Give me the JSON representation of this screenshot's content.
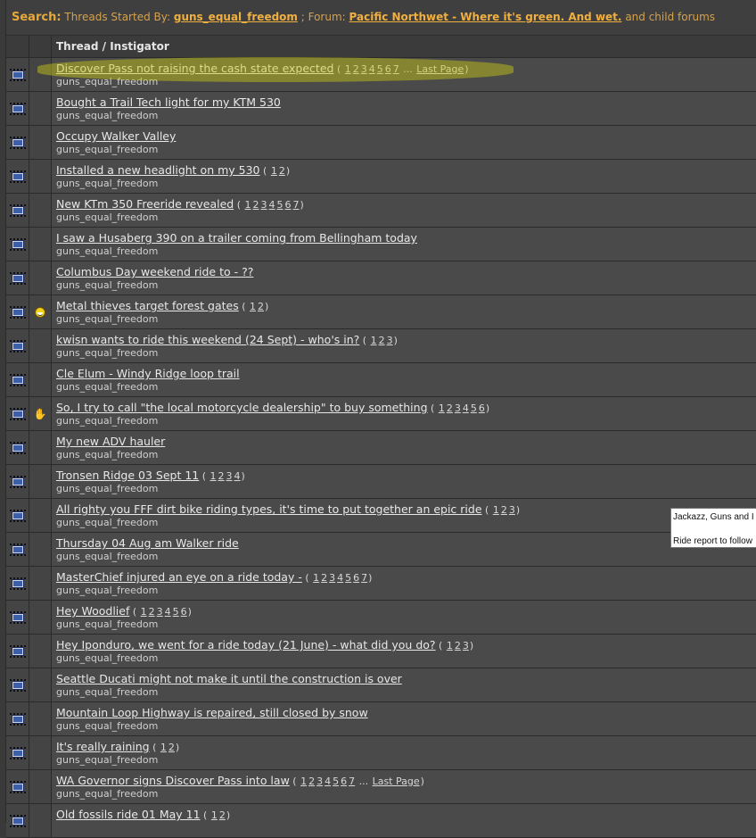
{
  "search": {
    "label": "Search:",
    "prefix": "Threads Started By:",
    "user": "guns_equal_freedom",
    "forum_sep": "; Forum:",
    "forum": "Pacific Northwet - Where it's green. And wet.",
    "suffix": "and child forums"
  },
  "header": {
    "thread_col": "Thread / Instigator"
  },
  "threads": [
    {
      "title": "Discover Pass not raising the cash state expected",
      "pages": [
        "1",
        "2",
        "3",
        "4",
        "5",
        "6",
        "7"
      ],
      "ellipsis": true,
      "last": "Last Page",
      "starter": "guns_equal_freedom",
      "post_icon": ""
    },
    {
      "title": "Bought a Trail Tech light for my KTM 530",
      "pages": [],
      "starter": "guns_equal_freedom",
      "post_icon": ""
    },
    {
      "title": "Occupy Walker Valley",
      "pages": [],
      "starter": "guns_equal_freedom",
      "post_icon": ""
    },
    {
      "title": "Installed a new headlight on my 530",
      "pages": [
        "1",
        "2"
      ],
      "starter": "guns_equal_freedom",
      "post_icon": ""
    },
    {
      "title": "New KTm 350 Freeride revealed",
      "pages": [
        "1",
        "2",
        "3",
        "4",
        "5",
        "6",
        "7"
      ],
      "starter": "guns_equal_freedom",
      "post_icon": ""
    },
    {
      "title": "I saw a Husaberg 390 on a trailer coming from Bellingham today",
      "pages": [],
      "starter": "guns_equal_freedom",
      "post_icon": ""
    },
    {
      "title": "Columbus Day weekend ride to - ??",
      "pages": [],
      "starter": "guns_equal_freedom",
      "post_icon": ""
    },
    {
      "title": "Metal thieves target forest gates",
      "pages": [
        "1",
        "2"
      ],
      "starter": "guns_equal_freedom",
      "post_icon": "grin-icon"
    },
    {
      "title": "kwisn wants to ride this weekend (24 Sept) - who's in?",
      "pages": [
        "1",
        "2",
        "3"
      ],
      "starter": "guns_equal_freedom",
      "post_icon": ""
    },
    {
      "title": "Cle Elum - Windy Ridge loop trail",
      "pages": [],
      "starter": "guns_equal_freedom",
      "post_icon": ""
    },
    {
      "title": "So, I try to call \"the local motorcycle dealership\" to buy something",
      "pages": [
        "1",
        "2",
        "3",
        "4",
        "5",
        "6"
      ],
      "starter": "guns_equal_freedom",
      "post_icon": "thumbs-down-icon"
    },
    {
      "title": "My new ADV hauler",
      "pages": [],
      "starter": "guns_equal_freedom",
      "post_icon": ""
    },
    {
      "title": "Tronsen Ridge 03 Sept 11",
      "pages": [
        "1",
        "2",
        "3",
        "4"
      ],
      "starter": "guns_equal_freedom",
      "post_icon": ""
    },
    {
      "title": "All righty you FFF dirt bike riding types, it's time to put together an epic ride",
      "pages": [
        "1",
        "2",
        "3"
      ],
      "starter": "guns_equal_freedom",
      "post_icon": ""
    },
    {
      "title": "Thursday 04 Aug am Walker ride",
      "pages": [],
      "starter": "guns_equal_freedom",
      "post_icon": ""
    },
    {
      "title": "MasterChief injured an eye on a ride today -",
      "pages": [
        "1",
        "2",
        "3",
        "4",
        "5",
        "6",
        "7"
      ],
      "starter": "guns_equal_freedom",
      "post_icon": ""
    },
    {
      "title": "Hey Woodlief",
      "pages": [
        "1",
        "2",
        "3",
        "4",
        "5",
        "6"
      ],
      "starter": "guns_equal_freedom",
      "post_icon": ""
    },
    {
      "title": "Hey Iponduro, we went for a ride today (21 June) - what did you do?",
      "pages": [
        "1",
        "2",
        "3"
      ],
      "starter": "guns_equal_freedom",
      "post_icon": ""
    },
    {
      "title": "Seattle Ducati might not make it until the construction is over",
      "pages": [],
      "starter": "guns_equal_freedom",
      "post_icon": ""
    },
    {
      "title": "Mountain Loop Highway is repaired, still closed by snow",
      "pages": [],
      "starter": "guns_equal_freedom",
      "post_icon": ""
    },
    {
      "title": "It's really raining",
      "pages": [
        "1",
        "2"
      ],
      "starter": "guns_equal_freedom",
      "post_icon": ""
    },
    {
      "title": "WA Governor signs Discover Pass into law",
      "pages": [
        "1",
        "2",
        "3",
        "4",
        "5",
        "6",
        "7"
      ],
      "ellipsis": true,
      "last": "Last Page",
      "starter": "guns_equal_freedom",
      "post_icon": ""
    },
    {
      "title": "Old fossils ride 01 May 11",
      "pages": [
        "1",
        "2"
      ],
      "starter": "",
      "post_icon": ""
    }
  ],
  "tooltip": {
    "line1": "Jackazz, Guns and I",
    "line2": "Ride report to follow"
  },
  "colors": {
    "accent": "#e7a93a",
    "highlight": "#cdcd14"
  }
}
